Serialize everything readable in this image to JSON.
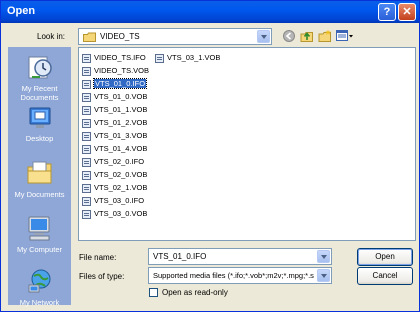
{
  "titlebar": {
    "title": "Open",
    "help_label": "?",
    "close_label": "✕"
  },
  "lookin": {
    "label": "Look in:",
    "value": "VIDEO_TS"
  },
  "places": [
    {
      "label": "My Recent Documents",
      "icon": "recent-documents-icon"
    },
    {
      "label": "Desktop",
      "icon": "desktop-icon"
    },
    {
      "label": "My Documents",
      "icon": "my-documents-icon"
    },
    {
      "label": "My Computer",
      "icon": "my-computer-icon"
    },
    {
      "label": "My Network",
      "icon": "my-network-icon"
    }
  ],
  "files": [
    "VIDEO_TS.IFO",
    "VIDEO_TS.VOB",
    "VTS_01_0.IFO",
    "VTS_01_0.VOB",
    "VTS_01_1.VOB",
    "VTS_01_2.VOB",
    "VTS_01_3.VOB",
    "VTS_01_4.VOB",
    "VTS_02_0.IFO",
    "VTS_02_0.VOB",
    "VTS_02_1.VOB",
    "VTS_03_0.IFO",
    "VTS_03_0.VOB",
    "VTS_03_1.VOB"
  ],
  "selected_file": "VTS_01_0.IFO",
  "filename": {
    "label": "File name:",
    "value": "VTS_01_0.IFO"
  },
  "filetype": {
    "label": "Files of type:",
    "value": "Supported media files (*.ifo;*.vob*;m2v;*.mpg;*.s"
  },
  "readonly": {
    "label": "Open as read-only"
  },
  "buttons": {
    "open": "Open",
    "cancel": "Cancel"
  },
  "colors": {
    "title_bar": "#0a5fe8",
    "places_bar": "#8fa7d6",
    "selection": "#316ac5",
    "dialog_bg": "#ece9d8"
  }
}
